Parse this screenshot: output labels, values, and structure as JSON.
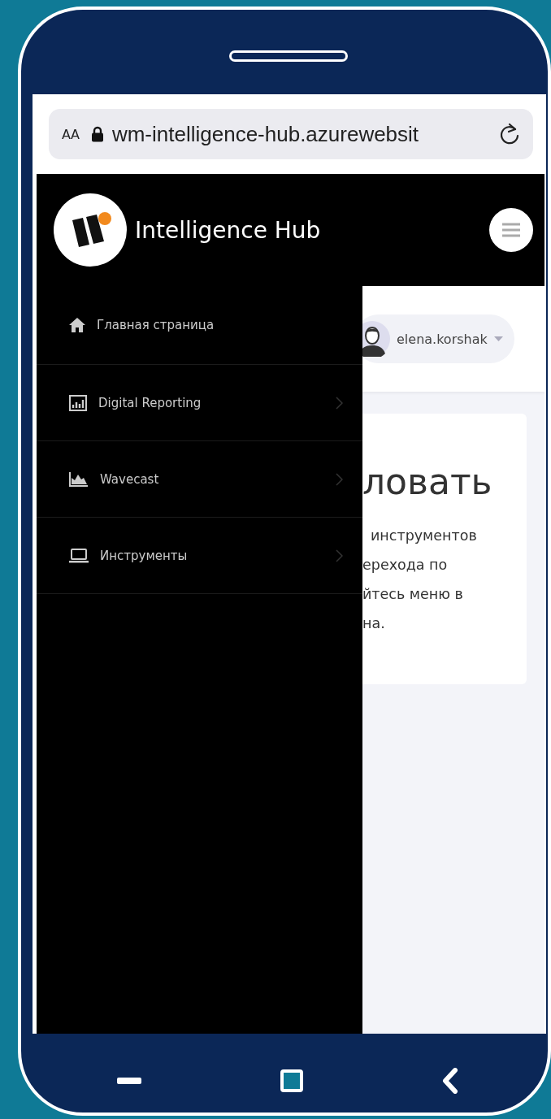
{
  "browser": {
    "text_size_button": "AA",
    "url": "wm-intelligence-hub.azurewebsit"
  },
  "header": {
    "title": "Intelligence Hub"
  },
  "sidebar": {
    "items": [
      {
        "label": "Главная страница",
        "has_children": false
      },
      {
        "label": "Digital Reporting",
        "has_children": true
      },
      {
        "label": "Wavecast",
        "has_children": true
      },
      {
        "label": "Инструменты",
        "has_children": true
      }
    ]
  },
  "user_menu": {
    "username": "elena.korshak"
  },
  "card": {
    "heading": "ловать",
    "lines": [
      "инструментов",
      "ерехода по",
      "йтесь меню в",
      "на."
    ]
  }
}
